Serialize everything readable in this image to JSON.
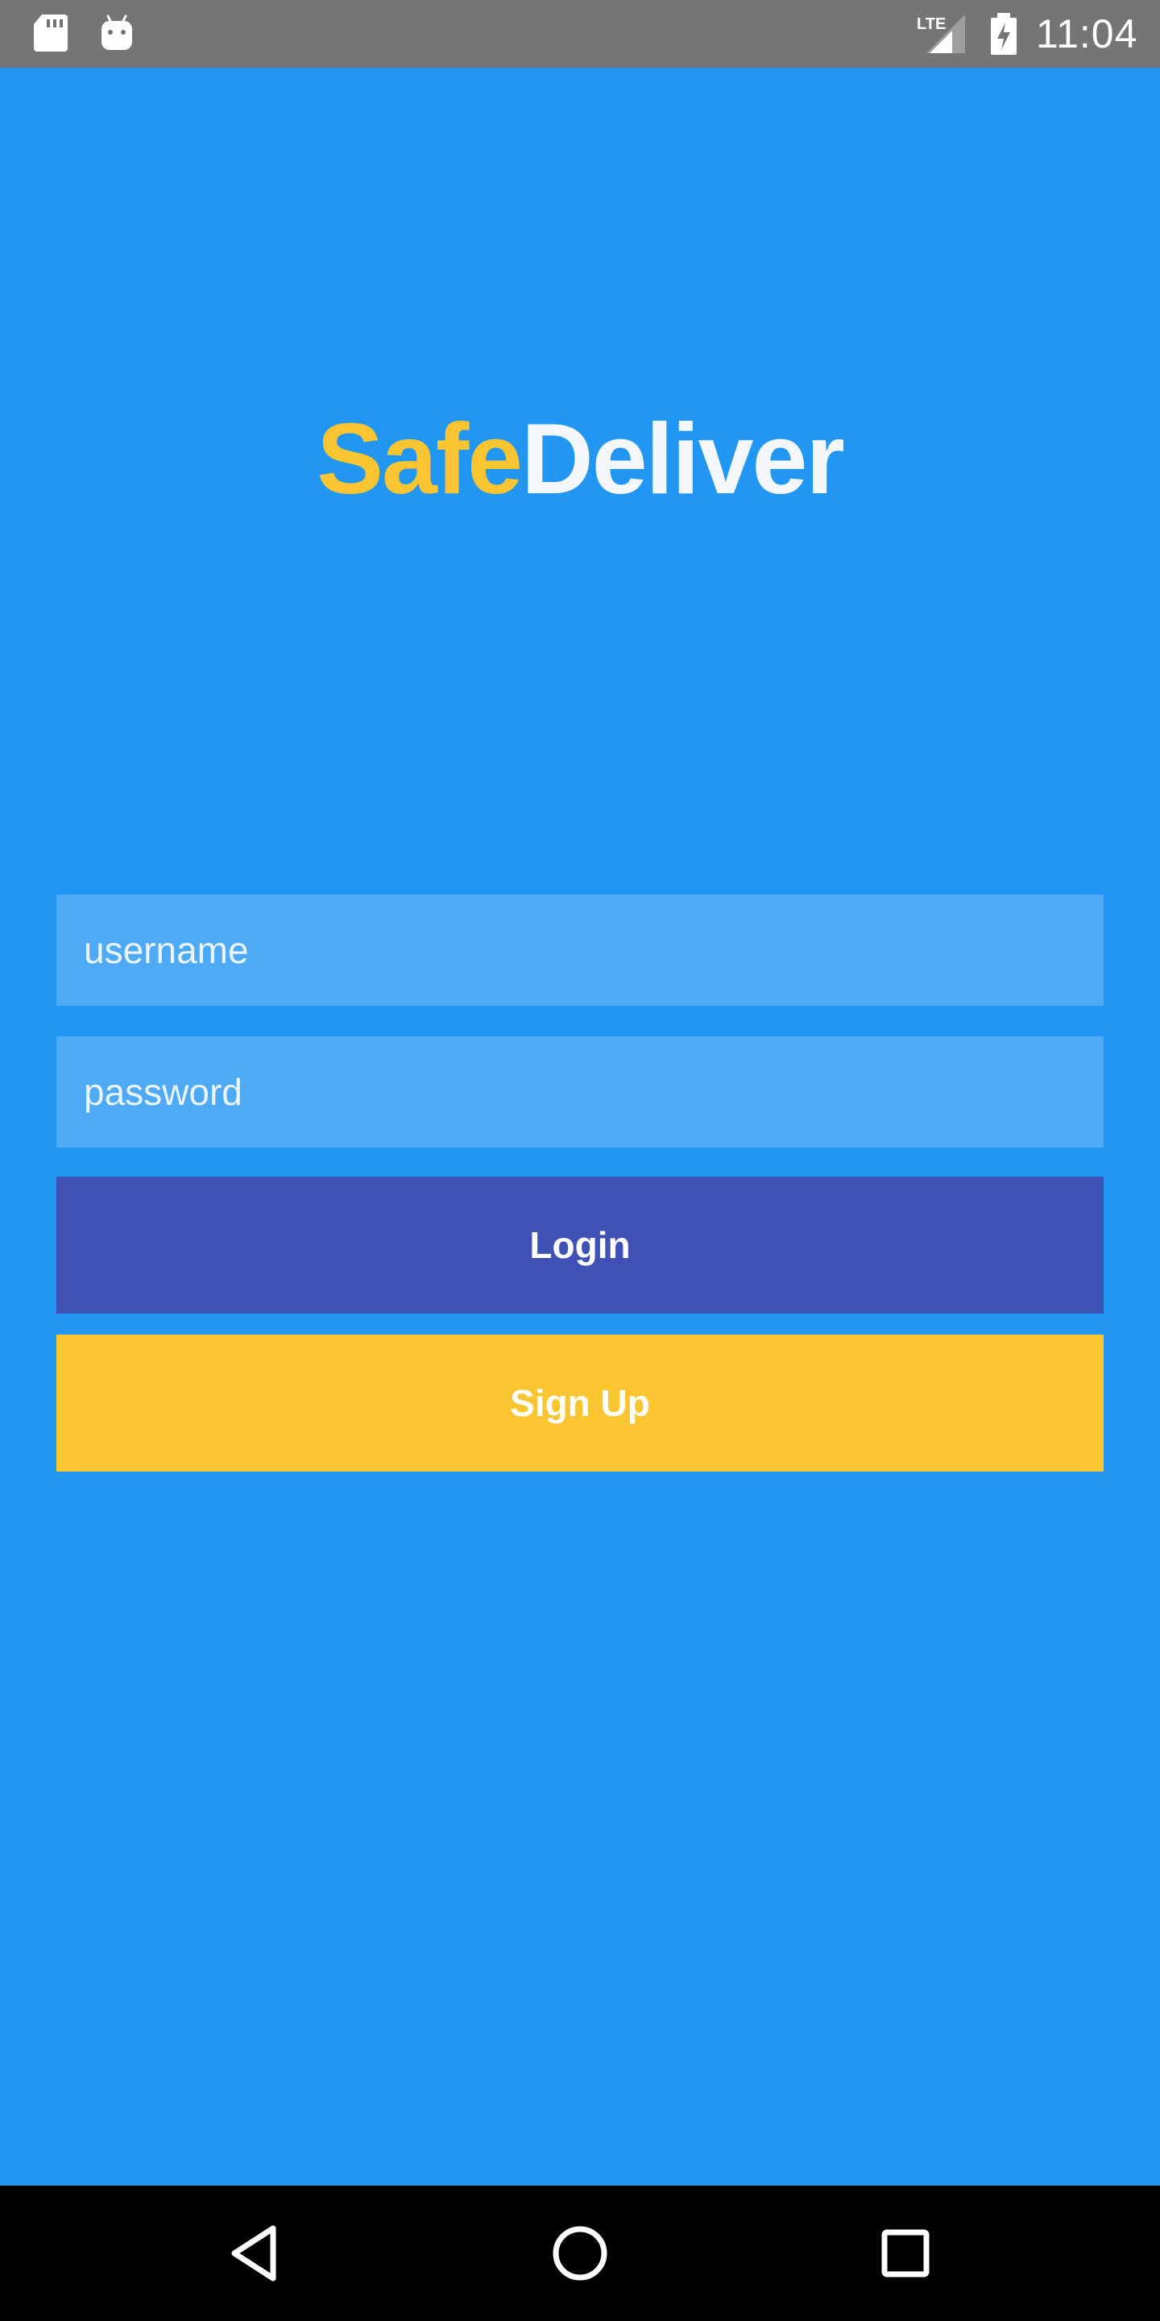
{
  "status_bar": {
    "time": "11:04",
    "left_icons": [
      "sd-card-icon",
      "android-icon"
    ],
    "right_icons": [
      "lte-signal-icon",
      "battery-charging-icon"
    ],
    "network_label": "LTE"
  },
  "logo": {
    "part1": "Safe",
    "part2": "Deliver",
    "part1_color": "#FBC531",
    "part2_color": "#F4F7FB"
  },
  "form": {
    "username_placeholder": "username",
    "username_value": "",
    "password_placeholder": "password",
    "password_value": ""
  },
  "buttons": {
    "login_label": "Login",
    "signup_label": "Sign Up"
  },
  "nav_bar": {
    "icons": [
      "back-icon",
      "home-icon",
      "recents-icon"
    ]
  },
  "colors": {
    "background": "#2196F3",
    "field_background": "#4FAAF5",
    "login_button": "#3F51B5",
    "signup_button": "#FBC531",
    "status_bar": "#757575",
    "nav_bar": "#000000"
  }
}
